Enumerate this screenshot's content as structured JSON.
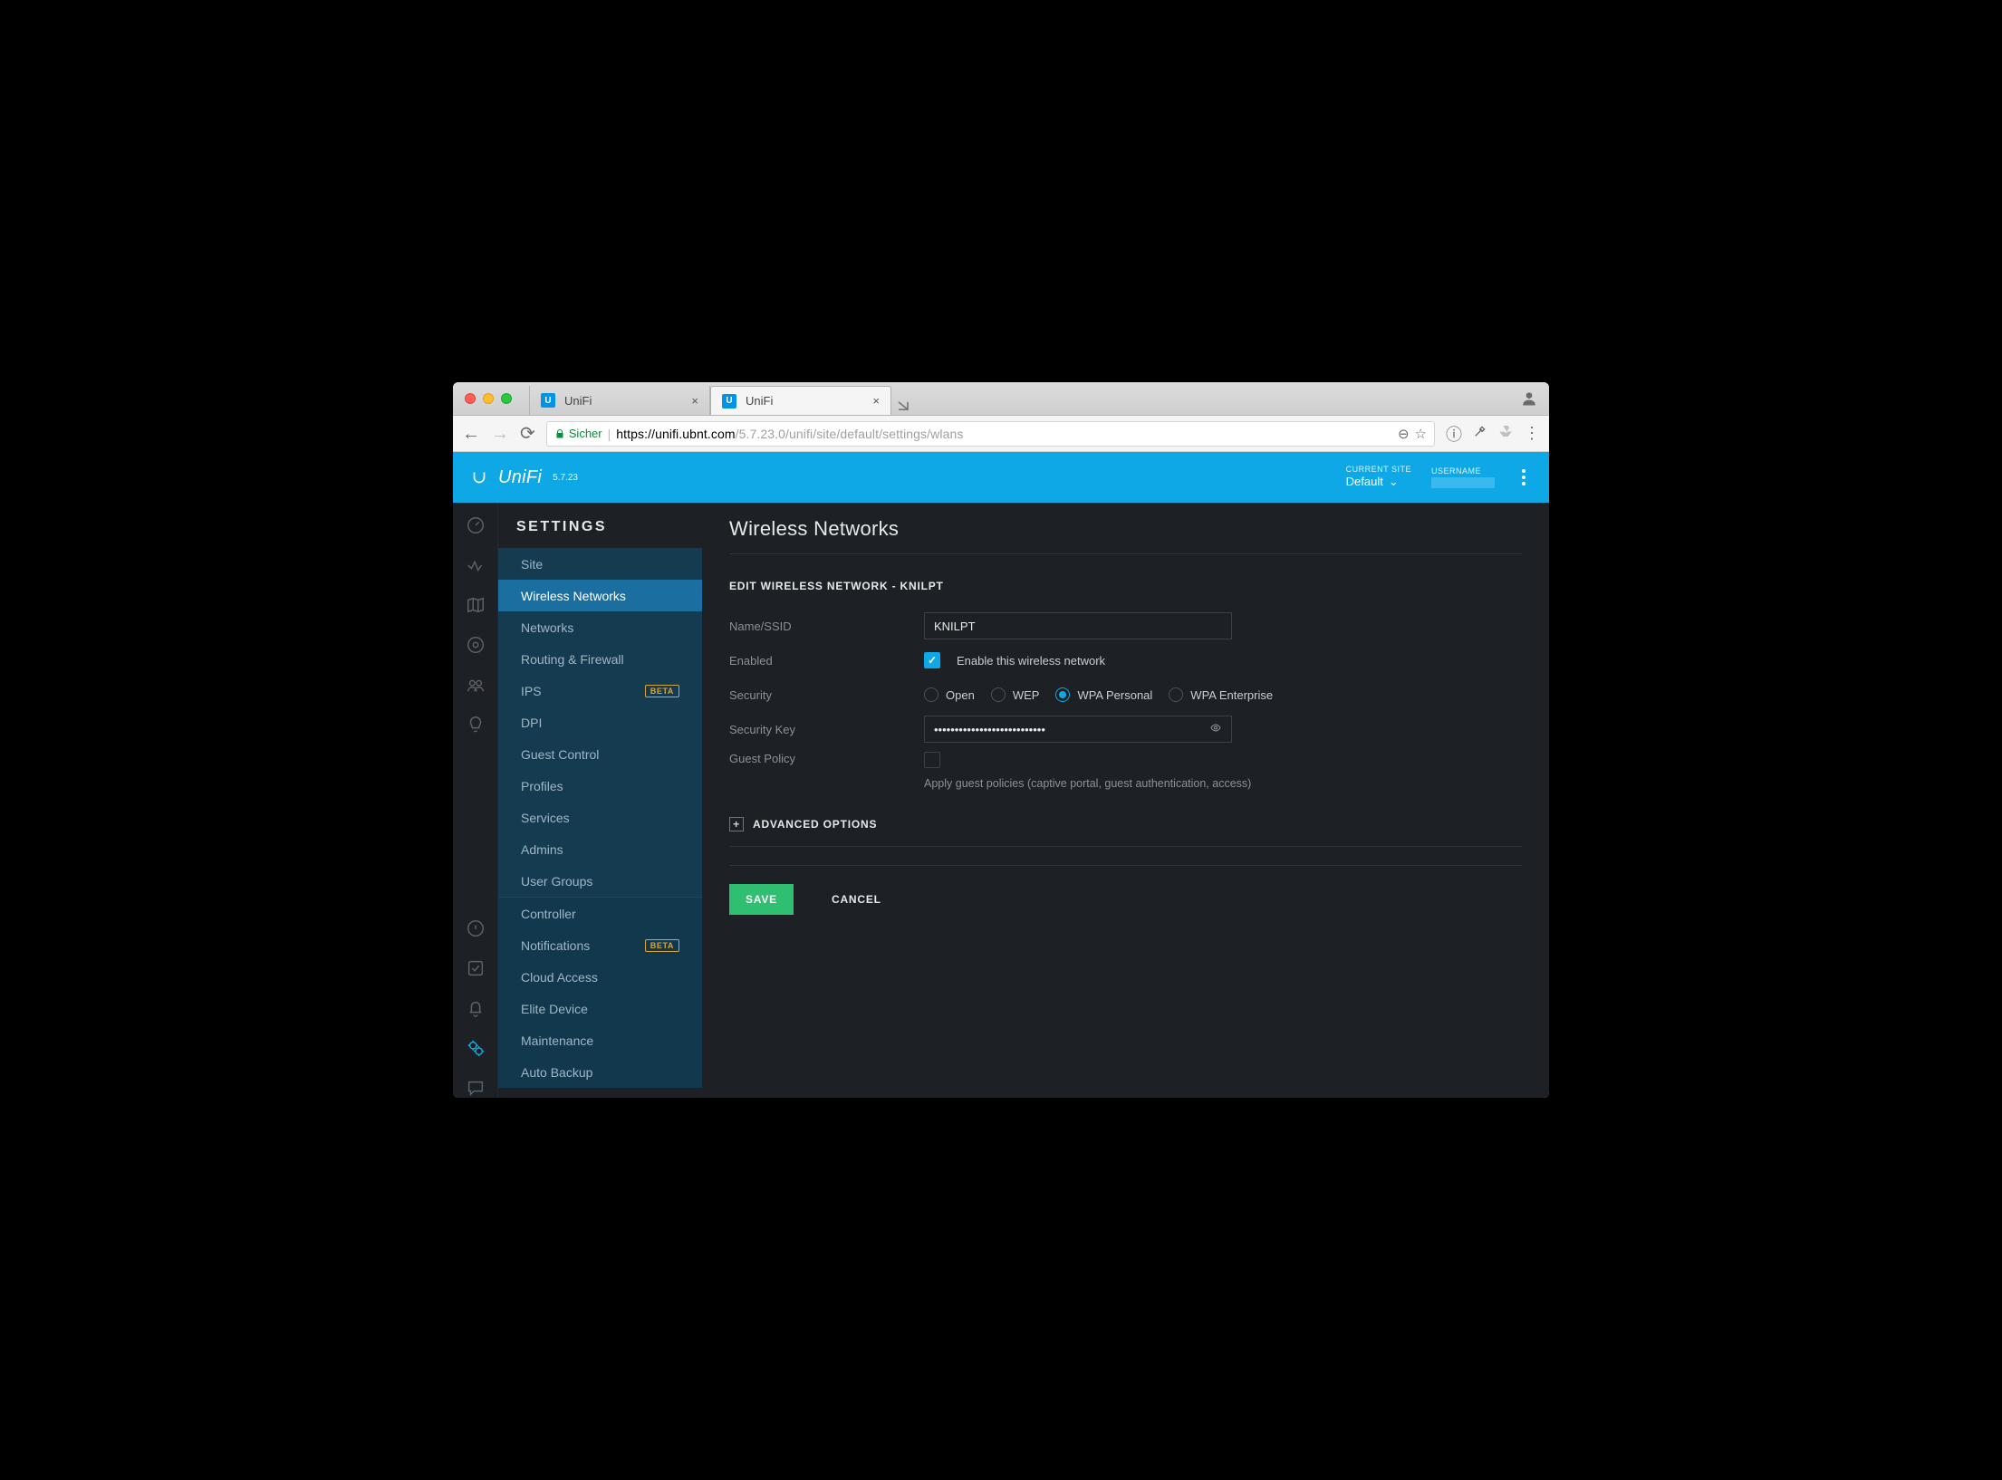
{
  "browser": {
    "tabs": [
      {
        "title": "UniFi",
        "active": false
      },
      {
        "title": "UniFi",
        "active": true
      }
    ],
    "secure_label": "Sicher",
    "url_host": "https://unifi.ubnt.com",
    "url_path": "/5.7.23.0/unifi/site/default/settings/wlans"
  },
  "header": {
    "product": "UniFi",
    "version": "5.7.23",
    "current_site_label": "CURRENT SITE",
    "current_site_value": "Default",
    "username_label": "USERNAME"
  },
  "settings_title": "SETTINGS",
  "settings_nav": {
    "group1": [
      {
        "label": "Site"
      },
      {
        "label": "Wireless Networks",
        "active": true
      },
      {
        "label": "Networks"
      },
      {
        "label": "Routing & Firewall"
      },
      {
        "label": "IPS",
        "beta": true
      },
      {
        "label": "DPI"
      },
      {
        "label": "Guest Control"
      },
      {
        "label": "Profiles"
      },
      {
        "label": "Services"
      },
      {
        "label": "Admins"
      },
      {
        "label": "User Groups"
      }
    ],
    "group2": [
      {
        "label": "Controller"
      },
      {
        "label": "Notifications",
        "beta": true
      },
      {
        "label": "Cloud Access"
      },
      {
        "label": "Elite Device"
      },
      {
        "label": "Maintenance"
      },
      {
        "label": "Auto Backup"
      }
    ]
  },
  "page": {
    "title": "Wireless Networks",
    "panel_title": "EDIT WIRELESS NETWORK - KNILPT",
    "fields": {
      "name_label": "Name/SSID",
      "name_value": "KNILPT",
      "enabled_label": "Enabled",
      "enabled_text": "Enable this wireless network",
      "enabled_checked": true,
      "security_label": "Security",
      "security_options": [
        "Open",
        "WEP",
        "WPA Personal",
        "WPA Enterprise"
      ],
      "security_selected": "WPA Personal",
      "key_label": "Security Key",
      "key_value": "•••••••••••••••••••••••••••",
      "guest_label": "Guest Policy",
      "guest_hint": "Apply guest policies (captive portal, guest authentication, access)",
      "guest_checked": false
    },
    "advanced_label": "ADVANCED OPTIONS",
    "save_label": "SAVE",
    "cancel_label": "CANCEL",
    "beta_badge": "BETA"
  }
}
